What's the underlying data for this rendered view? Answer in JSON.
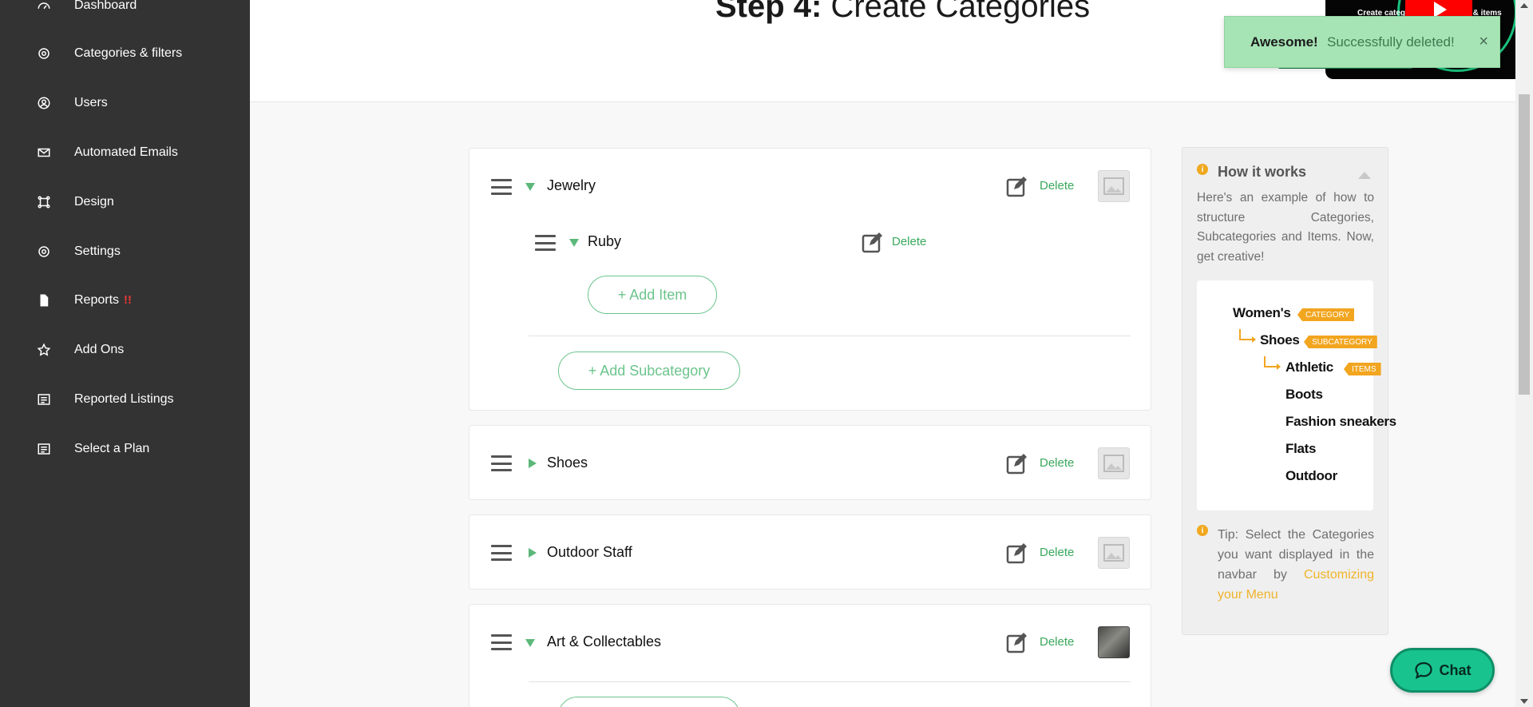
{
  "sidebar": {
    "items": [
      {
        "label": "Dashboard",
        "icon": "dashboard-icon"
      },
      {
        "label": "Categories & filters",
        "icon": "gear-icon"
      },
      {
        "label": "Users",
        "icon": "user-icon"
      },
      {
        "label": "Automated Emails",
        "icon": "envelope-icon"
      },
      {
        "label": "Design",
        "icon": "design-icon"
      },
      {
        "label": "Settings",
        "icon": "gear-icon"
      },
      {
        "label": "Reports",
        "icon": "document-icon",
        "alert": "!!"
      },
      {
        "label": "Add Ons",
        "icon": "star-icon"
      },
      {
        "label": "Reported Listings",
        "icon": "list-icon"
      },
      {
        "label": "Select a Plan",
        "icon": "list-icon"
      }
    ]
  },
  "header": {
    "title_bold": "Step 4:",
    "title_rest": " Create Categories",
    "video_caption": "Create categ",
    "video_caption_tail": "ries & items"
  },
  "toast": {
    "title": "Awesome!",
    "message": "Successfully deleted!",
    "close": "×"
  },
  "categories": [
    {
      "name": "Jewelry",
      "expanded": true,
      "delete_label": "Delete",
      "subcategories": [
        {
          "name": "Ruby",
          "expanded": true,
          "delete_label": "Delete",
          "add_item_label": "+ Add Item"
        }
      ],
      "add_subcategory_label": "+ Add Subcategory"
    },
    {
      "name": "Shoes",
      "expanded": false,
      "delete_label": "Delete"
    },
    {
      "name": "Outdoor Staff",
      "expanded": false,
      "delete_label": "Delete"
    },
    {
      "name": "Art & Collectables",
      "expanded": true,
      "delete_label": "Delete",
      "has_image": true
    }
  ],
  "how_it_works": {
    "title": "How it works",
    "description": "Here's an example of how to structure Categories, Subcategories and Items. Now, get creative!",
    "example": {
      "category": "Women's",
      "category_tag": "CATEGORY",
      "subcategory": "Shoes",
      "subcategory_tag": "SUBCATEGORY",
      "items": [
        "Athletic",
        "Boots",
        "Fashion sneakers",
        "Flats",
        "Outdoor"
      ],
      "items_tag": "ITEMS"
    },
    "tip_prefix": "Tip: Select the Categories you want displayed in the navbar by ",
    "tip_link": "Customizing your Menu"
  },
  "chat": {
    "label": "Chat"
  },
  "colors": {
    "sidebar_bg": "#333333",
    "accent_green": "#3aa85c",
    "tag_orange": "#f2a51f",
    "toast_bg": "#a6e3b5",
    "chat_bg": "#19c38e"
  }
}
